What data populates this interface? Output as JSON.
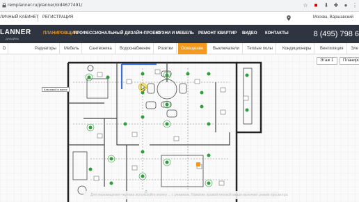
{
  "browser": {
    "url": "remplanner.ru/planner/oid4677491/"
  },
  "site_top": {
    "cabinet": "ЛИЧНЫЙ КАБИНЕТ",
    "register": "РЕГИСТРАЦИЯ",
    "city": "Москва, Варшавский"
  },
  "nav": {
    "logo": "LANNER",
    "logo_sub": "ДИЗАЙНА",
    "items": [
      "ПЛАНИРОВЩИК",
      "ПРОФЕССИОНАЛЬНЫЙ ДИЗАЙН-ПРОЕКТ",
      "КУХНИ И МЕБЕЛЬ",
      "РЕМОНТ КВАРТИР",
      "ВИДЕО",
      "КОНТАКТЫ"
    ],
    "phone": "8 (495) 798 6"
  },
  "tabs": [
    "D",
    "Радиаторы",
    "Мебель",
    "Сантехника",
    "Водоснабжение",
    "Розетки",
    "Освещение",
    "Выключатели",
    "Теплые полы",
    "Кондиционеры",
    "Вентиляция",
    "Эле"
  ],
  "canvas": {
    "floor_select": "Этаж 1",
    "plan_select": "Планировк",
    "side_note": "Ключевой в ванне",
    "bottom_note": "Для перемещения чертежа используйте кнопку ...  с режимом. Нажатие правой кнопкой мыши включает режим просмотра"
  },
  "colors": {
    "accent": "#f39a1e",
    "nav_bg": "#2e3540",
    "light_green": "#2f9e3a",
    "blue_wall": "#3d6fd8"
  }
}
